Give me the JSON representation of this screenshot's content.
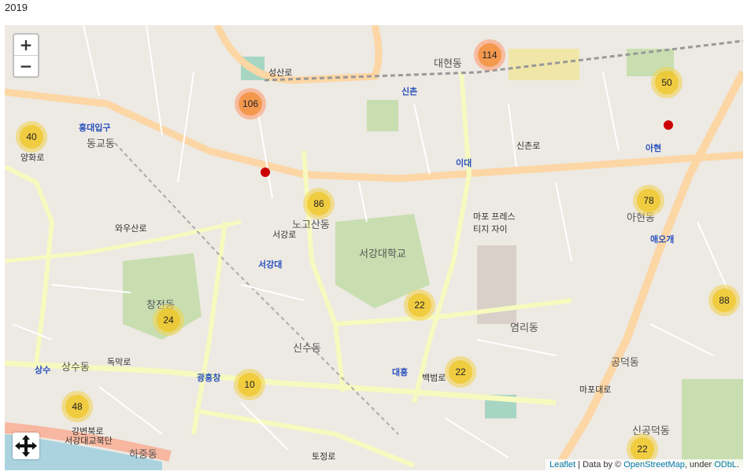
{
  "title": "2019",
  "zoom": {
    "in_label": "+",
    "out_label": "−"
  },
  "attribution": {
    "leaflet": "Leaflet",
    "separator": " | Data by © ",
    "osm": "OpenStreetMap",
    "under": ", under ",
    "odbl": "ODbL",
    "end": "."
  },
  "clusters": [
    {
      "id": "c1",
      "count": "114",
      "size": "large"
    },
    {
      "id": "c2",
      "count": "106",
      "size": "large"
    },
    {
      "id": "c3",
      "count": "50",
      "size": "med"
    },
    {
      "id": "c4",
      "count": "40",
      "size": "med"
    },
    {
      "id": "c5",
      "count": "86",
      "size": "med"
    },
    {
      "id": "c6",
      "count": "78",
      "size": "med"
    },
    {
      "id": "c7",
      "count": "22",
      "size": "med"
    },
    {
      "id": "c8",
      "count": "88",
      "size": "med"
    },
    {
      "id": "c9",
      "count": "24",
      "size": "med"
    },
    {
      "id": "c10",
      "count": "22",
      "size": "med"
    },
    {
      "id": "c11",
      "count": "10",
      "size": "med"
    },
    {
      "id": "c12",
      "count": "48",
      "size": "med"
    },
    {
      "id": "c13",
      "count": "22",
      "size": "med"
    }
  ],
  "places": {
    "daehyeon": "대현동",
    "sinchon": "신촌",
    "idae": "이대",
    "ahyeon": "아현",
    "hongdae": "홍대입구",
    "donggyo": "동교동",
    "sogang_univ": "서강대학교",
    "sogang_stn": "서강대",
    "nogosan": "노고산동",
    "changjeon": "창전동",
    "sinsu": "신수동",
    "gwangheungchang": "광흥창",
    "sangsu": "상수",
    "sangsu_dong": "상수동",
    "hajung": "하중동",
    "yeomni": "염리동",
    "daeheung": "대흥",
    "gongdeok": "공덕동",
    "singongdeok": "신공덕동",
    "aeogae": "애오개",
    "ahyeon_dong": "아현동",
    "mapo_presti": "마포 프레스티지 자이",
    "sinchon_ro": "신촌로",
    "seongsan_ro": "성산로",
    "dongmak_ro": "독막로",
    "mapo_daero": "마포대로",
    "baekbeom_ro": "백범로",
    "seogang_ro": "서강로",
    "wausan_ro": "와우산로",
    "yanghwa_ro": "양화로",
    "tojeong_ro": "토정로",
    "gangbyeon": "강변북로",
    "sogang_bridge": "서강대교북단"
  }
}
